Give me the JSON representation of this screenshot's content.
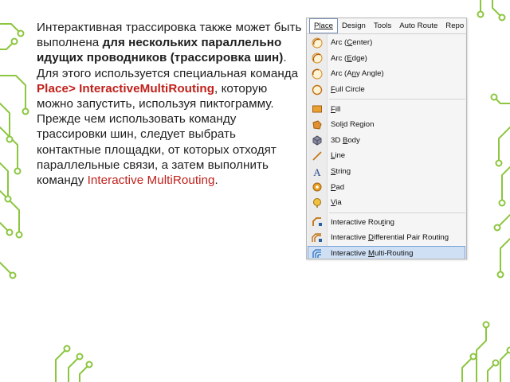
{
  "paragraph": {
    "t1": "Интерактивная трассировка также может быть выполнена ",
    "t2_bold": "для нескольких параллельно идущих проводников (трассировка шин)",
    "t3": ". Для этого используется специальная команда ",
    "t4_red": "Place> InteractiveMultiRouting",
    "t5": ", которую можно запустить, используя пиктограмму. Прежде чем использовать команду трассировки шин, следует выбрать контактные площадки, от которых отходят параллельные связи, а затем выполнить команду ",
    "t6_red": "Interactive MultiRouting",
    "t7": "."
  },
  "menubar": [
    "Place",
    "Design",
    "Tools",
    "Auto Route",
    "Repo"
  ],
  "menu_items": {
    "arc_center": {
      "pre": "Arc (",
      "u": "C",
      "post": "enter)",
      "icon": "arc-center-icon"
    },
    "arc_edge": {
      "pre": "Arc (",
      "u": "E",
      "post": "dge)",
      "icon": "arc-edge-icon"
    },
    "arc_any": {
      "pre": "Arc (A",
      "u": "n",
      "post": "y Angle)",
      "icon": "arc-any-angle-icon"
    },
    "full_circle": {
      "pre": "",
      "u": "F",
      "post": "ull Circle",
      "icon": "full-circle-icon"
    },
    "fill": {
      "pre": "",
      "u": "F",
      "post": "ill",
      "icon": "fill-icon"
    },
    "solid_region": {
      "pre": "Sol",
      "u": "i",
      "post": "d Region",
      "icon": "solid-region-icon"
    },
    "body3d": {
      "pre": "3D ",
      "u": "B",
      "post": "ody",
      "icon": "3d-body-icon"
    },
    "line": {
      "pre": "",
      "u": "L",
      "post": "ine",
      "icon": "line-icon"
    },
    "string": {
      "pre": "",
      "u": "S",
      "post": "tring",
      "icon": "string-icon"
    },
    "pad": {
      "pre": "",
      "u": "P",
      "post": "ad",
      "icon": "pad-icon"
    },
    "via": {
      "pre": "",
      "u": "V",
      "post": "ia",
      "icon": "via-icon"
    },
    "int_routing": {
      "pre": "Interactive Rou",
      "u": "t",
      "post": "ing",
      "icon": "interactive-routing-icon"
    },
    "int_diff": {
      "pre": "Interactive ",
      "u": "D",
      "post": "ifferential Pair Routing",
      "icon": "diff-pair-routing-icon"
    },
    "int_multi": {
      "pre": "Interactive ",
      "u": "M",
      "post": "ulti-Routing",
      "icon": "multi-routing-icon"
    }
  },
  "colors": {
    "text": "#1f1f1f",
    "accent_red": "#c0201a",
    "circuit_green": "#8cc63f",
    "highlight": "#cfe0f5"
  }
}
